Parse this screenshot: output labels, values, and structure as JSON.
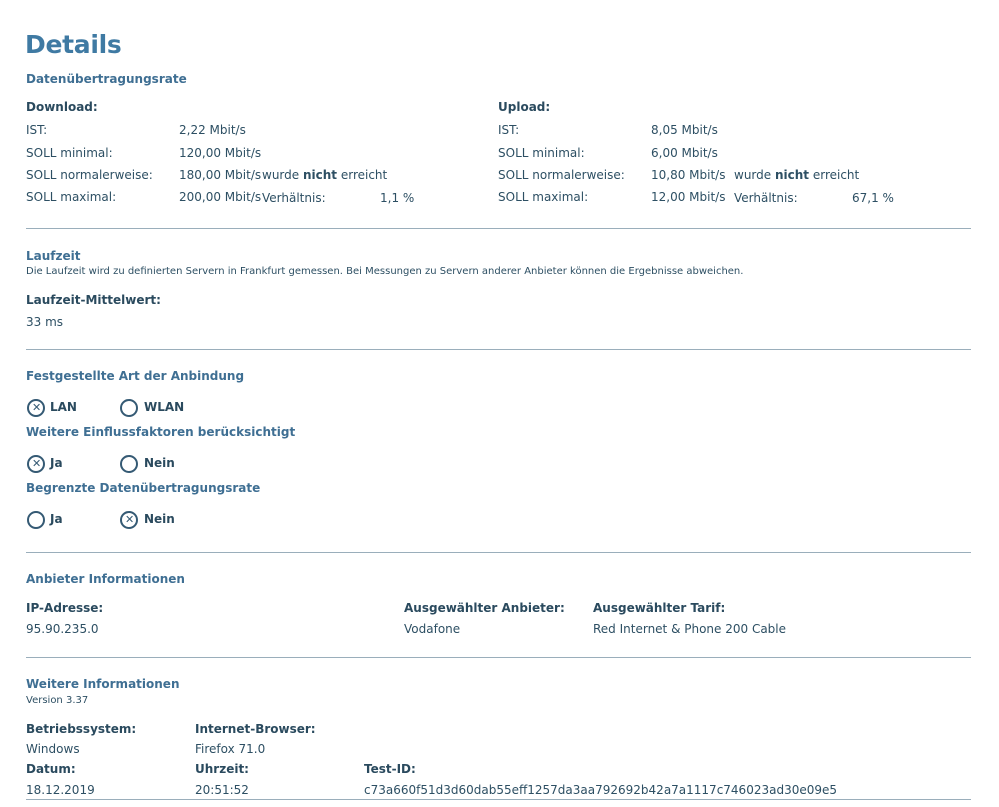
{
  "page_title": "Details",
  "rate": {
    "title": "Datenübertragungsrate",
    "download": {
      "heading": "Download:",
      "ist_label": "IST:",
      "ist_value": "2,22 Mbit/s",
      "min_label": "SOLL minimal:",
      "min_value": "120,00 Mbit/s",
      "normal_label": "SOLL normalerweise:",
      "normal_value": "180,00 Mbit/s",
      "max_label": "SOLL maximal:",
      "max_value": "200,00 Mbit/s",
      "reached_pre": "wurde ",
      "reached_bold": "nicht",
      "reached_post": " erreicht",
      "ratio_label": "Verhältnis:",
      "ratio_value": "1,1 %"
    },
    "upload": {
      "heading": "Upload:",
      "ist_label": "IST:",
      "ist_value": "8,05 Mbit/s",
      "min_label": "SOLL minimal:",
      "min_value": "6,00 Mbit/s",
      "normal_label": "SOLL normalerweise:",
      "normal_value": "10,80 Mbit/s",
      "max_label": "SOLL maximal:",
      "max_value": "12,00 Mbit/s",
      "reached_pre": "wurde ",
      "reached_bold": "nicht",
      "reached_post": " erreicht",
      "ratio_label": "Verhältnis:",
      "ratio_value": "67,1 %"
    }
  },
  "latency": {
    "title": "Laufzeit",
    "note": "Die Laufzeit wird zu definierten Servern in Frankfurt gemessen. Bei Messungen zu Servern anderer Anbieter können die Ergebnisse abweichen.",
    "avg_label": "Laufzeit-Mittelwert:",
    "avg_value": "33 ms"
  },
  "connection": {
    "type_title": "Festgestellte Art der Anbindung",
    "type_option_lan": "LAN",
    "type_option_wlan": "WLAN",
    "type_selected": "LAN",
    "factors_title": "Weitere Einflussfaktoren berücksichtigt",
    "factors_yes": "Ja",
    "factors_no": "Nein",
    "factors_selected": "Ja",
    "limited_title": "Begrenzte Datenübertragungsrate",
    "limited_yes": "Ja",
    "limited_no": "Nein",
    "limited_selected": "Nein"
  },
  "provider": {
    "title": "Anbieter Informationen",
    "ip_label": "IP-Adresse:",
    "ip_value": "95.90.235.0",
    "provider_label": "Ausgewählter Anbieter:",
    "provider_value": "Vodafone",
    "tariff_label": "Ausgewählter Tarif:",
    "tariff_value": "Red Internet & Phone 200 Cable"
  },
  "more": {
    "title": "Weitere Informationen",
    "version": "Version 3.37",
    "os_label": "Betriebssystem:",
    "os_value": "Windows",
    "browser_label": "Internet-Browser:",
    "browser_value": "Firefox 71.0",
    "date_label": "Datum:",
    "date_value": "18.12.2019",
    "time_label": "Uhrzeit:",
    "time_value": "20:51:52",
    "testid_label": "Test-ID:",
    "testid_value": "c73a660f51d3d60dab55eff1257da3aa792692b42a7a1117c746023ad30e09e5"
  }
}
